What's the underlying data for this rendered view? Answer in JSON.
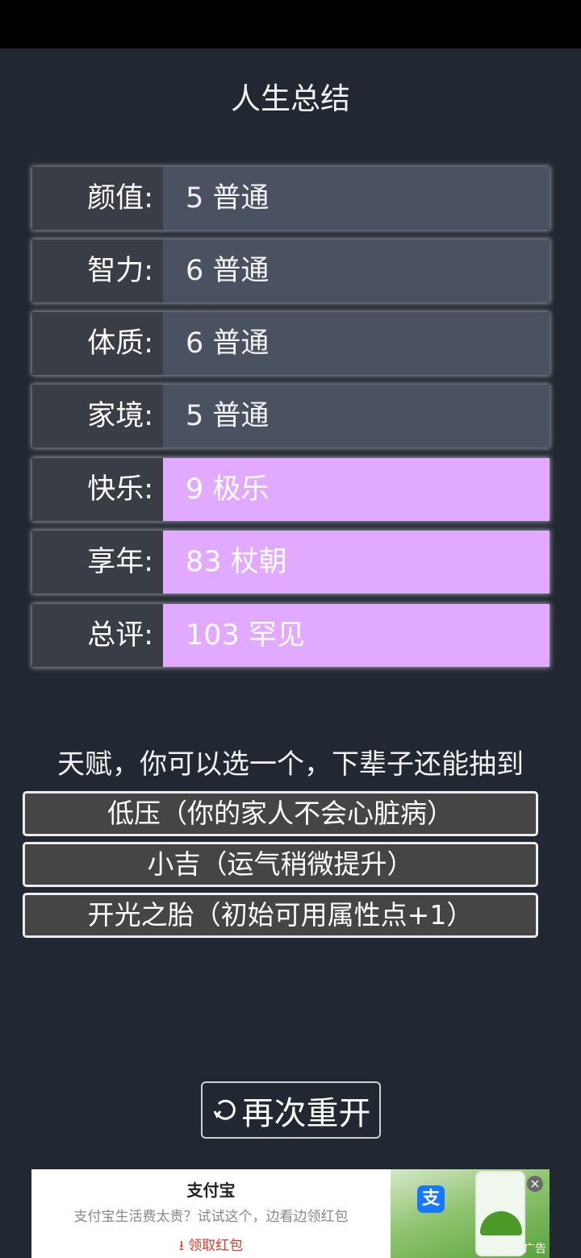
{
  "screen": {
    "title": "人生总结"
  },
  "stats": [
    {
      "label": "颜值:",
      "value": "5 普通",
      "highlight": false
    },
    {
      "label": "智力:",
      "value": "6 普通",
      "highlight": false
    },
    {
      "label": "体质:",
      "value": "6 普通",
      "highlight": false
    },
    {
      "label": "家境:",
      "value": "5 普通",
      "highlight": false
    },
    {
      "label": "快乐:",
      "value": "9 极乐",
      "highlight": true
    },
    {
      "label": "享年:",
      "value": "83 杖朝",
      "highlight": true
    },
    {
      "label": "总评:",
      "value": "103 罕见",
      "highlight": true
    }
  ],
  "talents": {
    "title": "天赋，你可以选一个，下辈子还能抽到",
    "options": [
      "低压（你的家人不会心脏病）",
      "小吉（运气稍微提升）",
      "开光之胎（初始可用属性点+1）"
    ]
  },
  "restart": {
    "label": "再次重开",
    "icon": "refresh-icon"
  },
  "ad": {
    "brand": "支付宝",
    "description": "支付宝生活费太贵？试试这个，边看边领红包",
    "cta": "领取红包",
    "cta_icon": "download-arrow-icon",
    "logo_text": "支",
    "ad_label": "广告",
    "close_icon": "close-icon"
  },
  "colors": {
    "background": "#222831",
    "label_bg": "#393e46",
    "normal_value_bg": "#4a5261",
    "highlight_value_bg": "#e1a9ff",
    "talent_bg": "#454545",
    "ad_cta": "#e23b2e"
  }
}
